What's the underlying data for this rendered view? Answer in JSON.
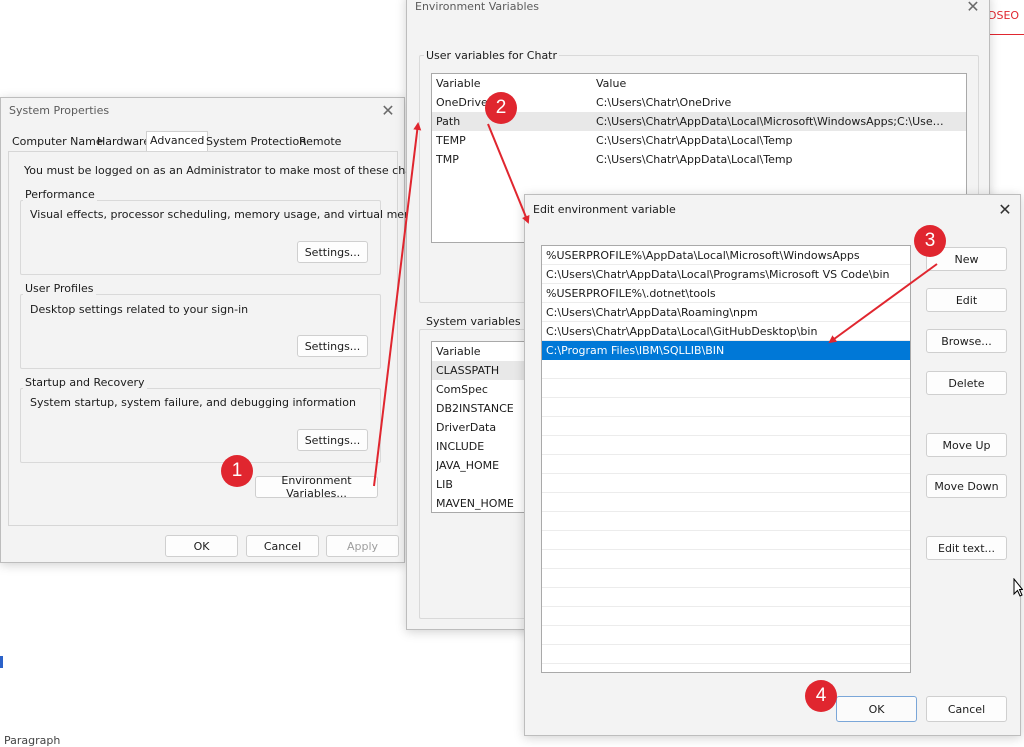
{
  "system_properties": {
    "title": "System Properties",
    "tabs": [
      "Computer Name",
      "Hardware",
      "Advanced",
      "System Protection",
      "Remote"
    ],
    "admin_notice": "You must be logged on as an Administrator to make most of these changes.",
    "performance": {
      "label": "Performance",
      "desc": "Visual effects, processor scheduling, memory usage, and virtual memory",
      "button": "Settings..."
    },
    "user_profiles": {
      "label": "User Profiles",
      "desc": "Desktop settings related to your sign-in",
      "button": "Settings..."
    },
    "startup": {
      "label": "Startup and Recovery",
      "desc": "System startup, system failure, and debugging information",
      "button": "Settings..."
    },
    "env_button": "Environment Variables...",
    "ok": "OK",
    "cancel": "Cancel",
    "apply": "Apply"
  },
  "env_vars": {
    "title": "Environment Variables",
    "user_group": "User variables for Chatr",
    "user_headers": [
      "Variable",
      "Value"
    ],
    "user_rows": [
      {
        "name": "OneDrive",
        "value": "C:\\Users\\Chatr\\OneDrive"
      },
      {
        "name": "Path",
        "value": "C:\\Users\\Chatr\\AppData\\Local\\Microsoft\\WindowsApps;C:\\Users..."
      },
      {
        "name": "TEMP",
        "value": "C:\\Users\\Chatr\\AppData\\Local\\Temp"
      },
      {
        "name": "TMP",
        "value": "C:\\Users\\Chatr\\AppData\\Local\\Temp"
      }
    ],
    "system_group": "System variables",
    "system_header": "Variable",
    "system_rows": [
      "CLASSPATH",
      "ComSpec",
      "DB2INSTANCE",
      "DriverData",
      "INCLUDE",
      "JAVA_HOME",
      "LIB",
      "MAVEN_HOME"
    ]
  },
  "edit_env": {
    "title": "Edit environment variable",
    "entries": [
      "%USERPROFILE%\\AppData\\Local\\Microsoft\\WindowsApps",
      "C:\\Users\\Chatr\\AppData\\Local\\Programs\\Microsoft VS Code\\bin",
      "%USERPROFILE%\\.dotnet\\tools",
      "C:\\Users\\Chatr\\AppData\\Roaming\\npm",
      "C:\\Users\\Chatr\\AppData\\Local\\GitHubDesktop\\bin",
      "C:\\Program Files\\IBM\\SQLLIB\\BIN"
    ],
    "buttons": {
      "new": "New",
      "edit": "Edit",
      "browse": "Browse...",
      "delete": "Delete",
      "move_up": "Move Up",
      "move_down": "Move Down",
      "edit_text": "Edit text...",
      "ok": "OK",
      "cancel": "Cancel"
    }
  },
  "badges": [
    "1",
    "2",
    "3",
    "4"
  ],
  "background": {
    "top_right_text": "DSEO",
    "bottom_left_text": "Paragraph"
  },
  "colors": {
    "badge_red": "#e0262f",
    "selection_blue": "#0078d7",
    "highlight_row": "#e8e8e8"
  }
}
